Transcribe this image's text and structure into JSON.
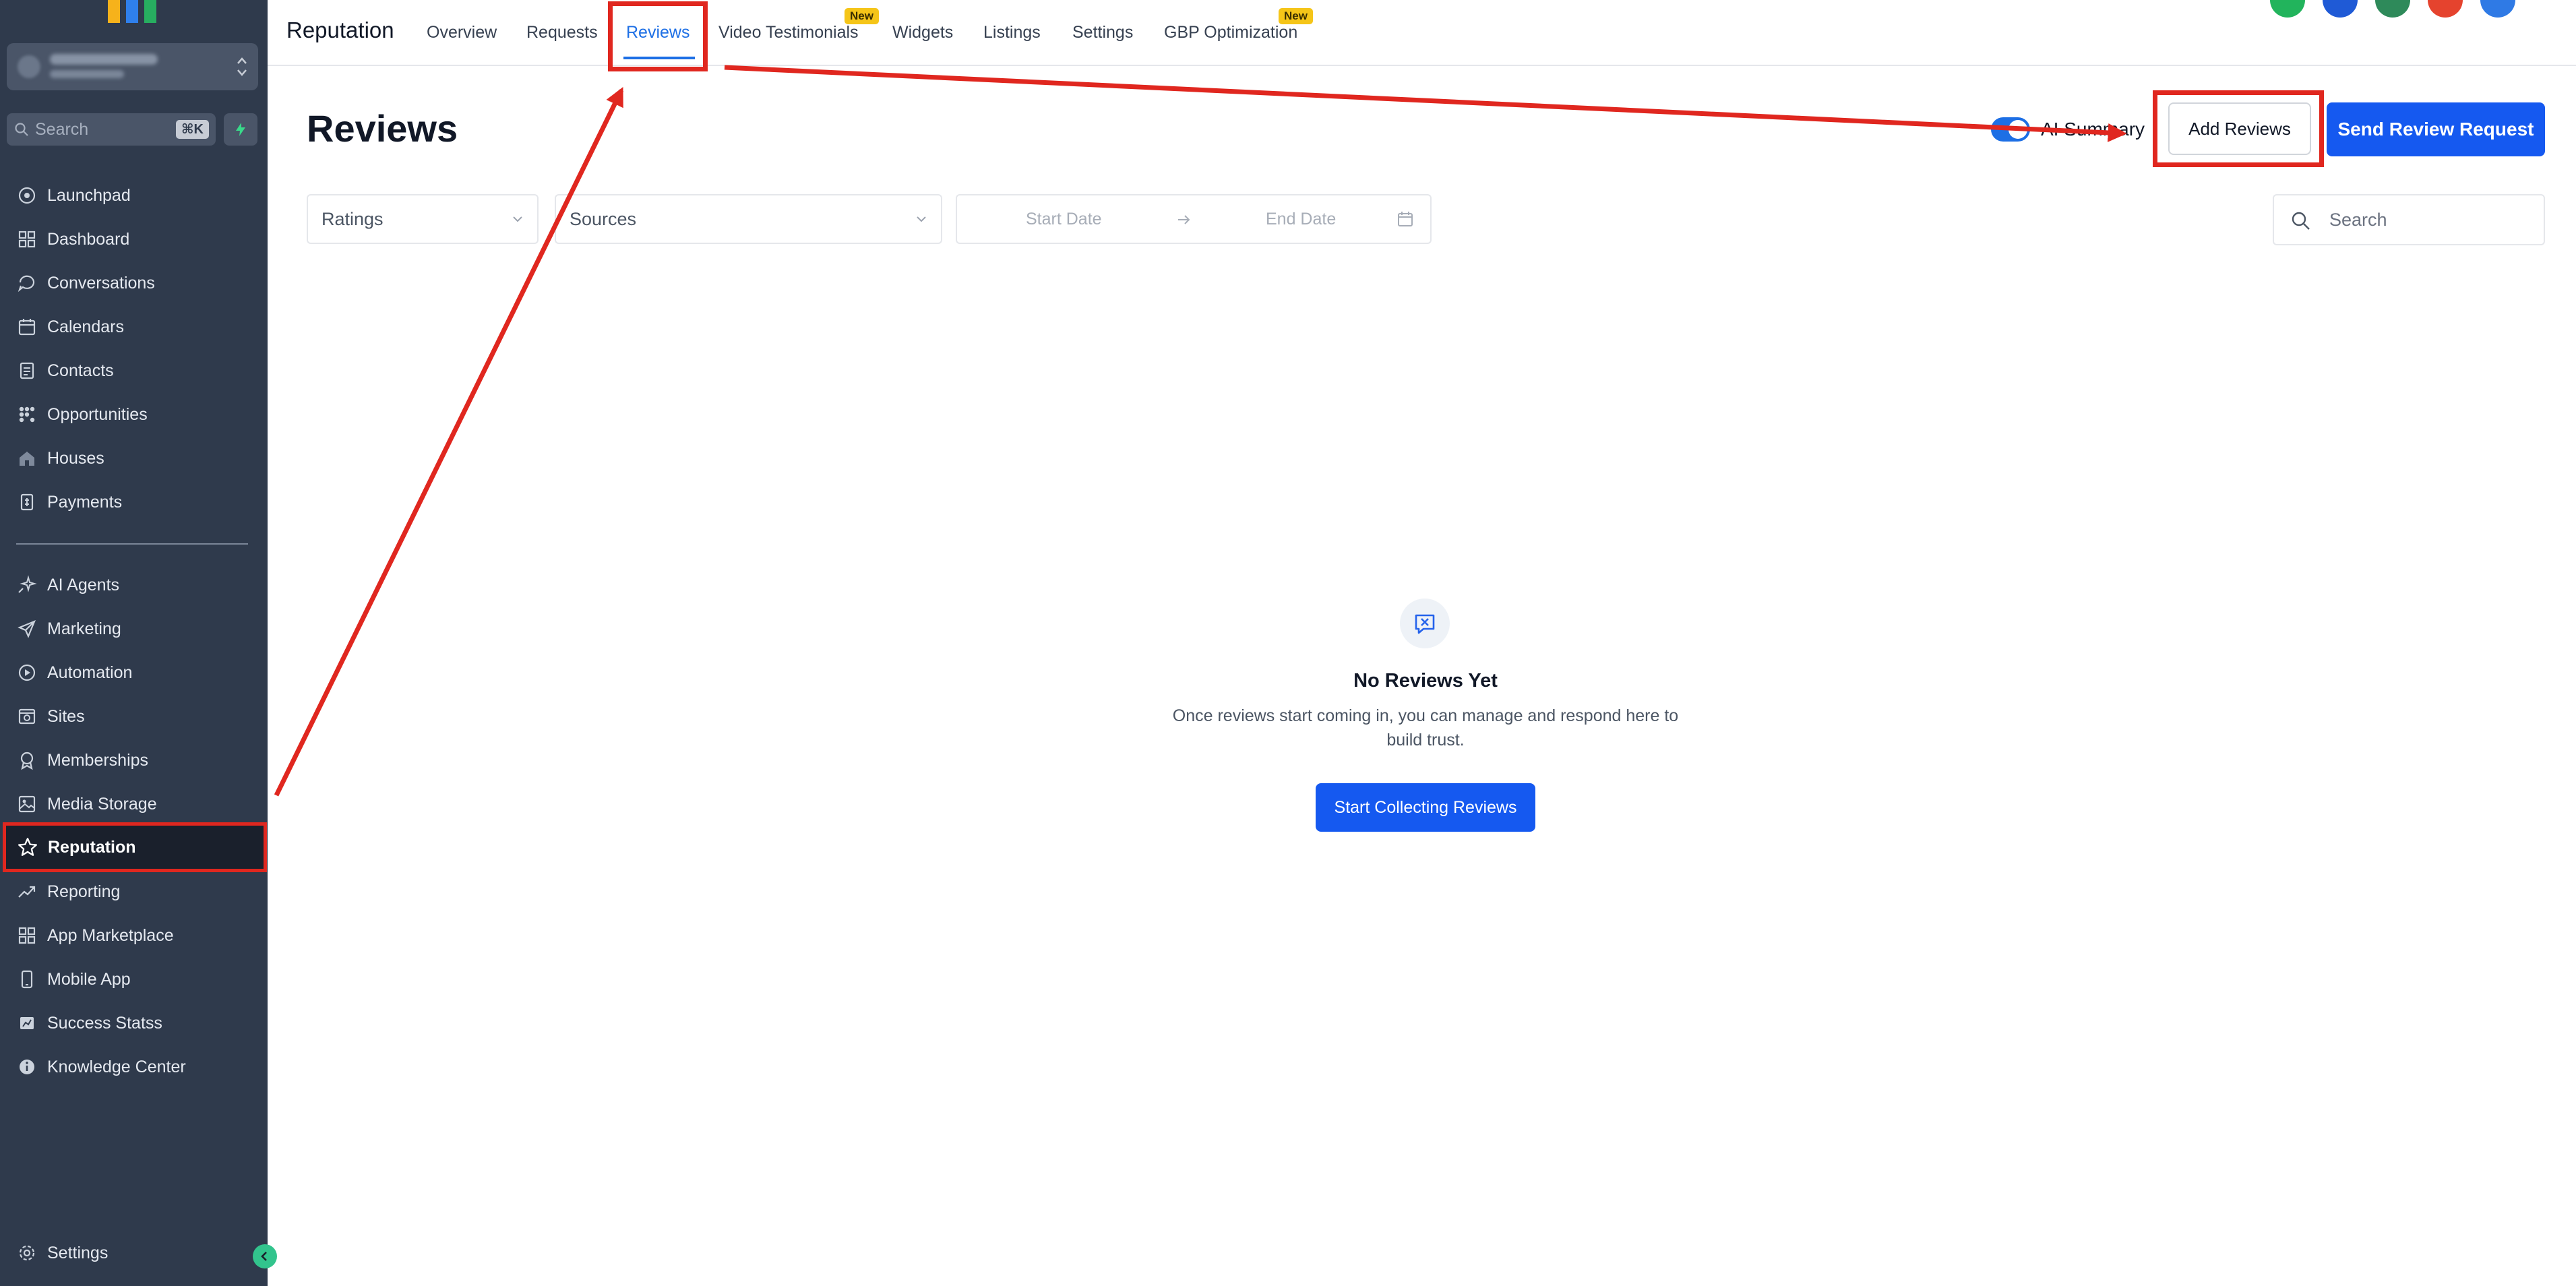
{
  "sidebar": {
    "search_placeholder": "Search",
    "search_shortcut": "⌘K",
    "items": [
      {
        "label": "Launchpad",
        "icon": "launchpad-icon"
      },
      {
        "label": "Dashboard",
        "icon": "dashboard-icon"
      },
      {
        "label": "Conversations",
        "icon": "chat-bubble-icon"
      },
      {
        "label": "Calendars",
        "icon": "calendar-icon"
      },
      {
        "label": "Contacts",
        "icon": "contacts-icon"
      },
      {
        "label": "Opportunities",
        "icon": "opportunities-icon"
      },
      {
        "label": "Houses",
        "icon": "house-icon"
      },
      {
        "label": "Payments",
        "icon": "payments-icon"
      },
      {
        "label": "AI Agents",
        "icon": "sparkle-icon"
      },
      {
        "label": "Marketing",
        "icon": "paper-plane-icon"
      },
      {
        "label": "Automation",
        "icon": "automation-icon"
      },
      {
        "label": "Sites",
        "icon": "sites-icon"
      },
      {
        "label": "Memberships",
        "icon": "award-icon"
      },
      {
        "label": "Media Storage",
        "icon": "image-icon"
      },
      {
        "label": "Reputation",
        "icon": "star-icon",
        "active": true
      },
      {
        "label": "Reporting",
        "icon": "trend-up-icon"
      },
      {
        "label": "App Marketplace",
        "icon": "grid-icon"
      },
      {
        "label": "Mobile App",
        "icon": "mobile-icon"
      },
      {
        "label": "Success Statss",
        "icon": "stats-icon"
      },
      {
        "label": "Knowledge Center",
        "icon": "info-icon"
      }
    ],
    "settings_label": "Settings"
  },
  "header": {
    "app_title": "Reputation",
    "tabs": [
      {
        "label": "Overview"
      },
      {
        "label": "Requests"
      },
      {
        "label": "Reviews",
        "active": true
      },
      {
        "label": "Video Testimonials",
        "badge": "New"
      },
      {
        "label": "Widgets"
      },
      {
        "label": "Listings"
      },
      {
        "label": "Settings"
      },
      {
        "label": "GBP Optimization",
        "badge": "New"
      }
    ]
  },
  "main": {
    "title": "Reviews",
    "ai_summary_label": "AI Summary",
    "ai_summary_on": true,
    "add_reviews_label": "Add Reviews",
    "send_request_label": "Send Review Request",
    "filters": {
      "ratings_placeholder": "Ratings",
      "sources_placeholder": "Sources",
      "start_date_placeholder": "Start Date",
      "end_date_placeholder": "End Date",
      "search_placeholder": "Search"
    },
    "empty_state": {
      "title": "No Reviews Yet",
      "description": "Once reviews start coming in, you can manage and respond here to build trust.",
      "cta_label": "Start Collecting Reviews"
    }
  },
  "colors": {
    "sidebar_bg": "#2f3a4c",
    "primary": "#1559f0",
    "annotation_red": "#e0271f",
    "tab_active": "#1d6fe5"
  }
}
